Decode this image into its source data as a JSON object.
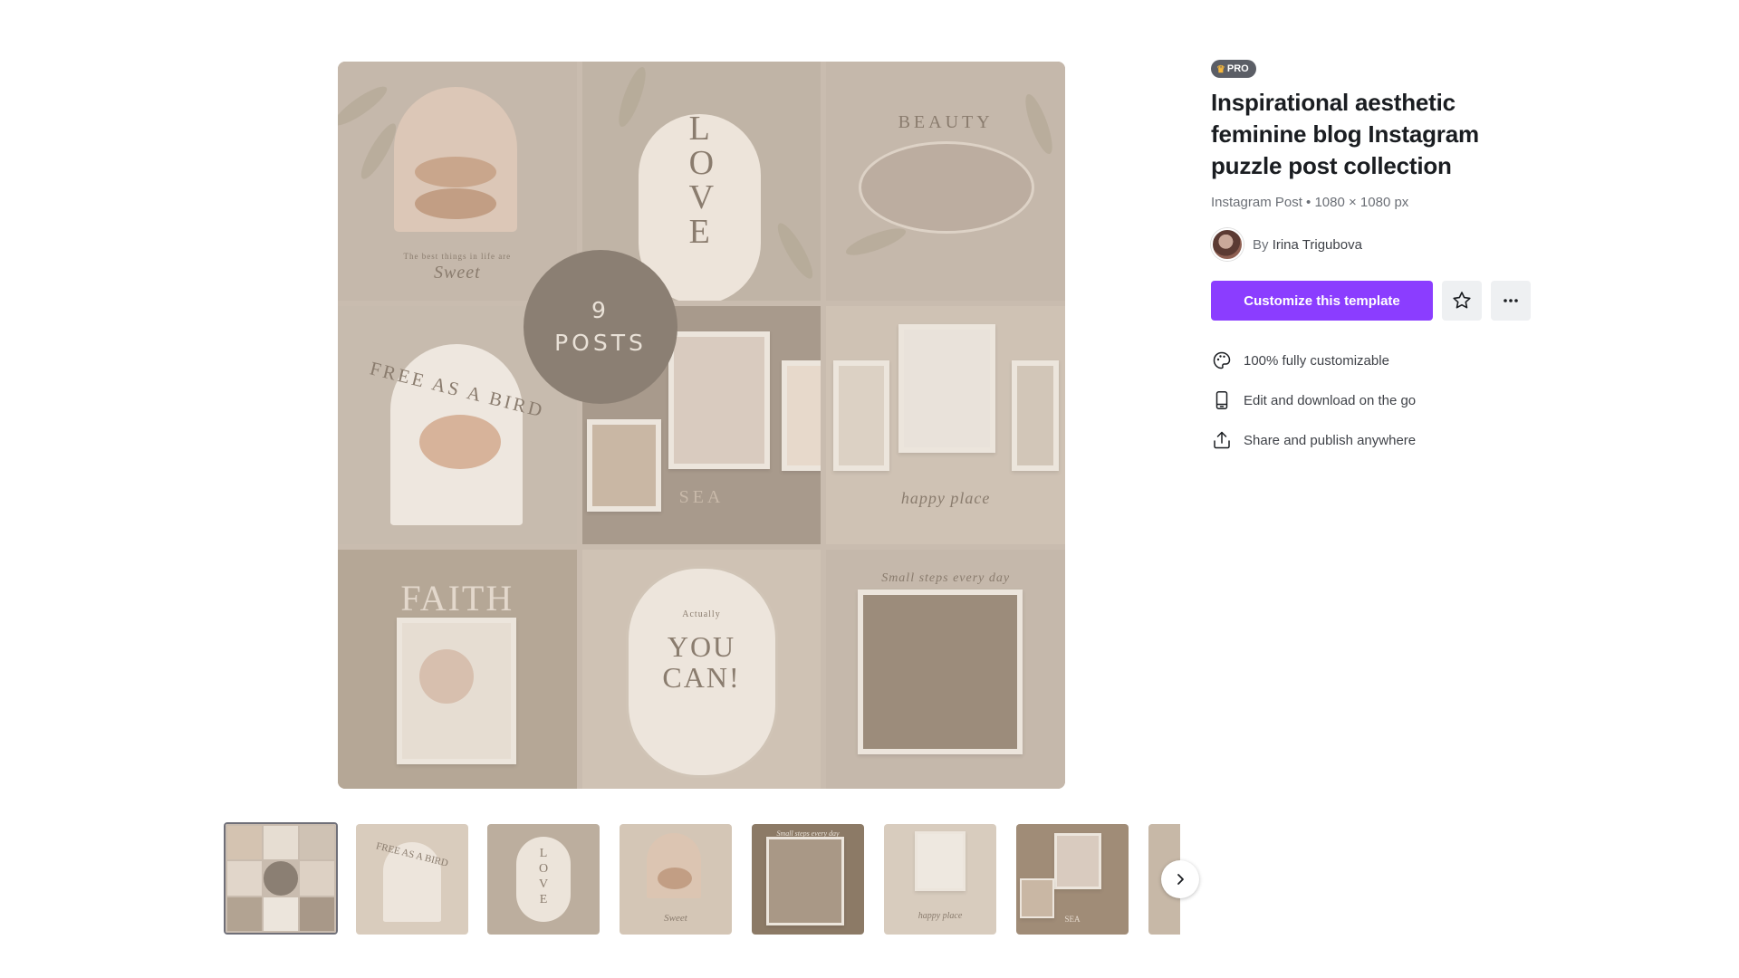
{
  "preview": {
    "badge_number": "9",
    "badge_word": "POSTS",
    "tiles": {
      "t1": "Sweet",
      "t1_small": "The best things in life are",
      "t2": "LOVE",
      "t3": "BEAUTY",
      "t4": "FREE AS A BIRD",
      "t5": "SEA",
      "t6": "happy place",
      "t7": "FAITH",
      "t8_small": "Actually",
      "t8": "YOU CAN!",
      "t9": "Small steps every day"
    }
  },
  "thumbnails": [
    {
      "label": "",
      "bg": "#c9bcaf"
    },
    {
      "label": "FREE AS A BIRD",
      "bg": "#d9ccbd"
    },
    {
      "label": "LOVE",
      "bg": "#bcae9e"
    },
    {
      "label": "Sweet",
      "bg": "#d4c6b6"
    },
    {
      "label": "Small steps every day",
      "bg": "#8c7a66"
    },
    {
      "label": "happy place",
      "bg": "#d8ccbe"
    },
    {
      "label": "SEA",
      "bg": "#a08c77"
    },
    {
      "label": "",
      "bg": "#c7b8a7"
    }
  ],
  "info": {
    "badge": "PRO",
    "title": "Inspirational aesthetic feminine blog Instagram puzzle post collection",
    "meta": "Instagram Post • 1080 × 1080 px",
    "by_prefix": "By",
    "author": "Irina Trigubova",
    "cta": "Customize this template",
    "features": [
      {
        "label": "100% fully customizable",
        "icon": "palette-icon"
      },
      {
        "label": "Edit and download on the go",
        "icon": "phone-icon"
      },
      {
        "label": "Share and publish anywhere",
        "icon": "share-icon"
      }
    ]
  },
  "colors": {
    "accent": "#8b3dff",
    "pro_badge": "#5b5e66",
    "crown": "#f6b73c"
  }
}
